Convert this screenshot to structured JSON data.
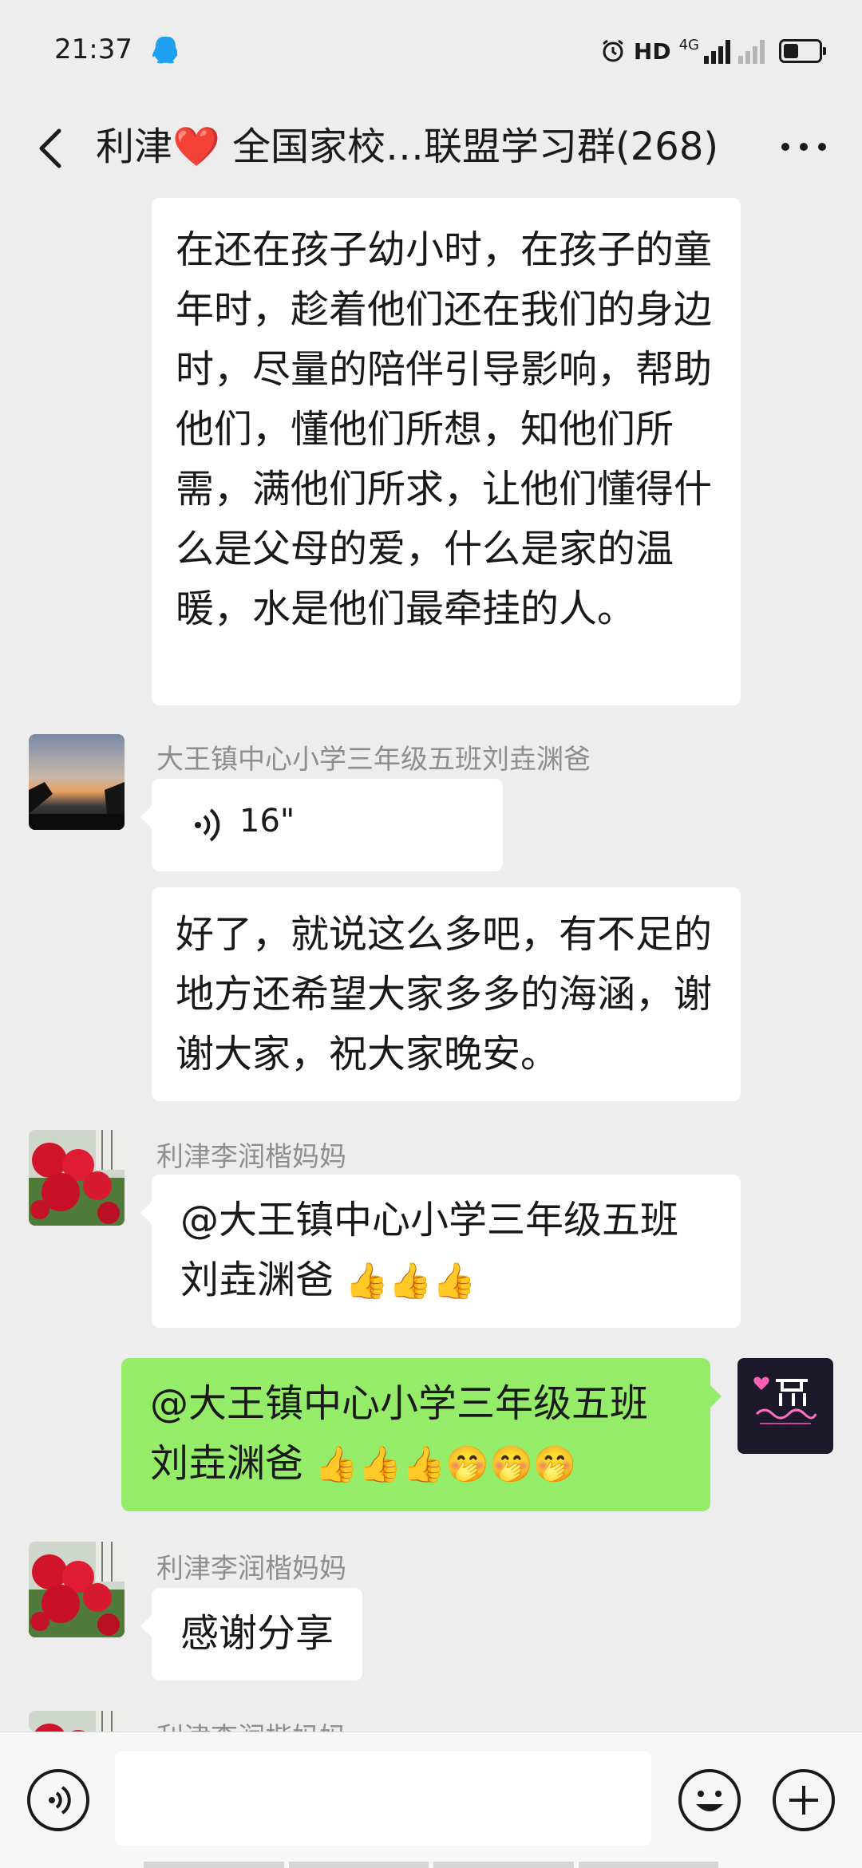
{
  "status_bar": {
    "time": "21:37",
    "network": "HD",
    "network_type": "4G",
    "icons": [
      "qq-icon",
      "alarm-icon",
      "signal-icon",
      "battery-icon"
    ]
  },
  "header": {
    "title_prefix": "利津",
    "title_heart": "❤️",
    "title_rest": " 全国家校…联盟学习群(268)"
  },
  "messages": [
    {
      "id": "m1",
      "side": "left",
      "text": "在还在孩子幼小时，在孩子的童年时，趁着他们还在我们的身边时，尽量的陪伴引导影响，帮助他们，懂他们所想，知他们所需，满他们所求，让他们懂得什么是父母的爱，什么是家的温暖，水是他们最牵挂的人。"
    },
    {
      "id": "m2",
      "side": "left",
      "sender": "大王镇中心小学三年级五班刘垚渊爸",
      "voice_duration": "16\""
    },
    {
      "id": "m3",
      "side": "left",
      "text": "好了，就说这么多吧，有不足的地方还希望大家多多的海涵，谢谢大家，祝大家晚安。"
    },
    {
      "id": "m4",
      "side": "left",
      "sender": "利津李润楷妈妈",
      "text": "@大王镇中心小学三年级五班刘垚渊爸",
      "emoji": " 👍👍👍"
    },
    {
      "id": "m5",
      "side": "right",
      "text": "@大王镇中心小学三年级五班刘垚渊爸",
      "emoji": " 👍👍👍🤭🤭🤭"
    },
    {
      "id": "m6",
      "side": "left",
      "sender": "利津李润楷妈妈",
      "text": "感谢分享"
    },
    {
      "id": "m7",
      "side": "left",
      "sender": "利津李润楷妈妈"
    }
  ],
  "input_bar": {
    "placeholder": ""
  },
  "colors": {
    "background": "#ededed",
    "bubble_in": "#ffffff",
    "bubble_out": "#95ec69",
    "sender_name": "#8e8e8e"
  }
}
